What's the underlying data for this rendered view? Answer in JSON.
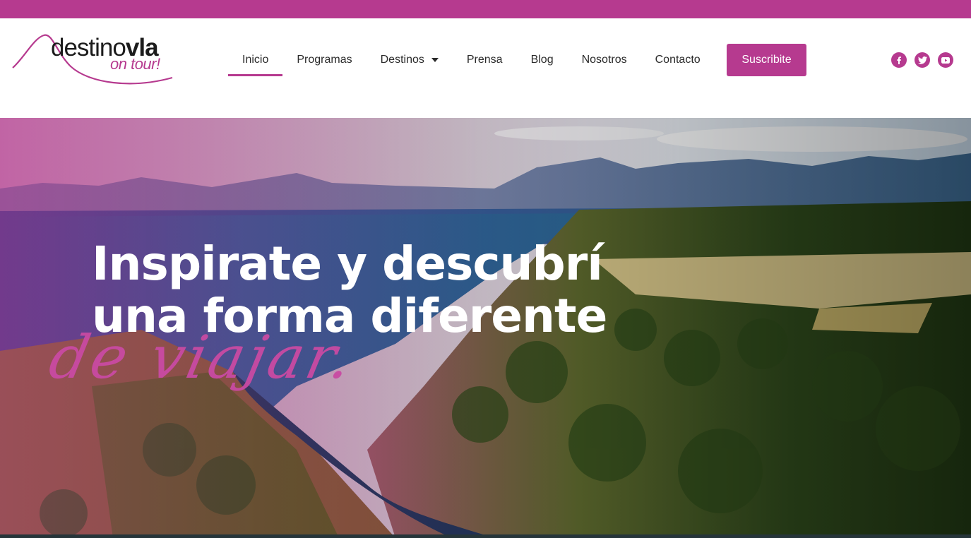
{
  "brand": {
    "logo_main_light": "destino",
    "logo_main_bold": "vla",
    "logo_sub": "on tour!",
    "accent_color": "#b63a8f"
  },
  "nav": {
    "items": [
      {
        "label": "Inicio",
        "active": true
      },
      {
        "label": "Programas"
      },
      {
        "label": "Destinos",
        "has_dropdown": true
      },
      {
        "label": "Prensa"
      },
      {
        "label": "Blog"
      },
      {
        "label": "Nosotros"
      },
      {
        "label": "Contacto"
      }
    ],
    "cta_label": "Suscribite"
  },
  "social": [
    {
      "icon": "facebook-icon"
    },
    {
      "icon": "twitter-icon"
    },
    {
      "icon": "youtube-icon"
    }
  ],
  "hero": {
    "headline_line1": "Inspirate y descubrí",
    "headline_line2": "una forma diferente",
    "script_text": "de viajar."
  }
}
